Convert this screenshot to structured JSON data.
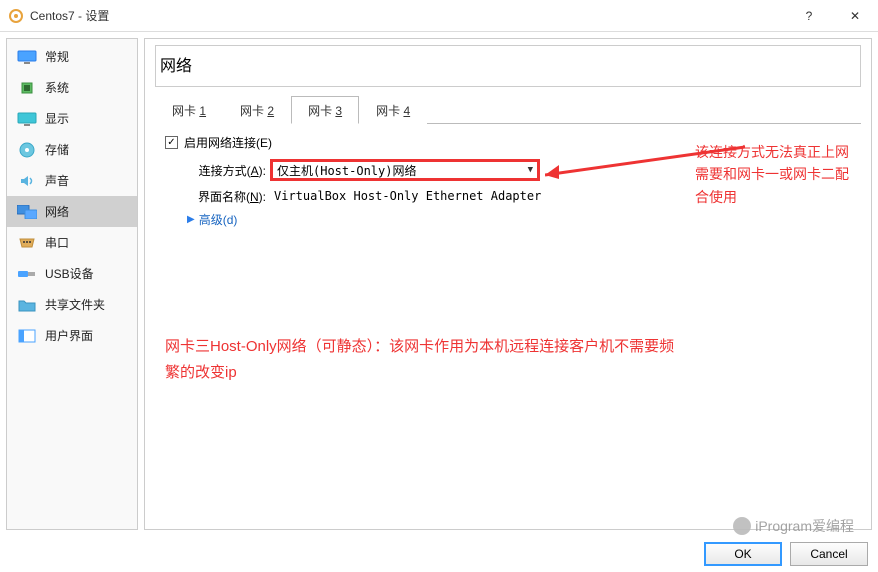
{
  "window": {
    "title": "Centos7 - 设置",
    "help": "?",
    "close": "✕"
  },
  "sidebar": {
    "items": [
      {
        "label": "常规",
        "icon": "monitor-blue"
      },
      {
        "label": "系统",
        "icon": "chip"
      },
      {
        "label": "显示",
        "icon": "monitor"
      },
      {
        "label": "存储",
        "icon": "disk"
      },
      {
        "label": "声音",
        "icon": "speaker"
      },
      {
        "label": "网络",
        "icon": "network"
      },
      {
        "label": "串口",
        "icon": "serial"
      },
      {
        "label": "USB设备",
        "icon": "usb"
      },
      {
        "label": "共享文件夹",
        "icon": "folder"
      },
      {
        "label": "用户界面",
        "icon": "ui"
      }
    ],
    "active_index": 5
  },
  "main": {
    "section_title": "网络",
    "tabs": [
      {
        "prefix": "网卡 ",
        "num": "1"
      },
      {
        "prefix": "网卡 ",
        "num": "2"
      },
      {
        "prefix": "网卡 ",
        "num": "3"
      },
      {
        "prefix": "网卡 ",
        "num": "4"
      }
    ],
    "active_tab": 2,
    "enable_label_pre": "启用网络连接(",
    "enable_label_u": "E",
    "enable_label_post": ")",
    "enable_checked": true,
    "conn_label_pre": "连接方式(",
    "conn_label_u": "A",
    "conn_label_post": "):",
    "conn_value": "仅主机(Host-Only)网络",
    "iface_label_pre": "界面名称(",
    "iface_label_u": "N",
    "iface_label_post": "):",
    "iface_value": "VirtualBox Host-Only Ethernet Adapter",
    "advanced_pre": "高级(",
    "advanced_u": "d",
    "advanced_post": ")"
  },
  "annotations": {
    "side": "该连接方式无法真正上网需要和网卡一或网卡二配合使用",
    "body": "网卡三Host-Only网络（可静态）：该网卡作用为本机远程连接客户机不需要频繁的改变ip"
  },
  "footer": {
    "ok": "OK",
    "cancel": "Cancel"
  },
  "watermark": "iProgram爱编程"
}
